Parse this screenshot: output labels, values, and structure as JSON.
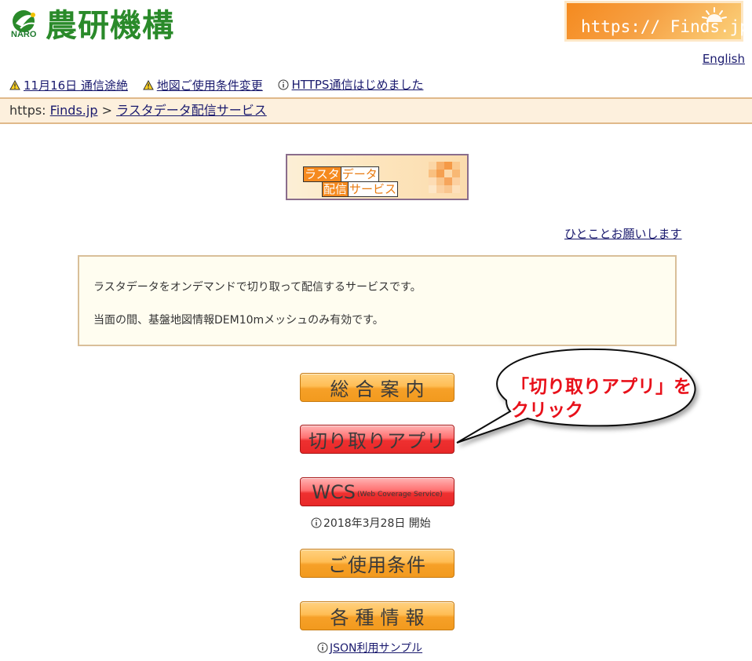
{
  "header": {
    "org_name": "農研機構",
    "org_sub": "NARO",
    "finds_banner": "https:// Finds.jp",
    "english_link": "English"
  },
  "notices": [
    {
      "icon": "warning-icon",
      "label": "11月16日 通信途絶"
    },
    {
      "icon": "warning-icon",
      "label": "地図ご使用条件変更"
    },
    {
      "icon": "info-icon",
      "label": "HTTPS通信はじめました"
    }
  ],
  "breadcrumb": {
    "prefix": "https:",
    "home": "Finds.jp",
    "separator": ">",
    "current": "ラスタデータ配信サービス"
  },
  "service_logo": {
    "line1_orange": "ラスタ",
    "line1_white": "データ",
    "line2_orange": "配信",
    "line2_white": "サービス"
  },
  "hitokoto_link": "ひとことお願いします",
  "info_box": {
    "line1": "ラスタデータをオンデマンドで切り取って配信するサービスです。",
    "line2": "当面の間、基盤地図情報DEM10mメッシュのみ有効です。"
  },
  "buttons": {
    "general_guide": "総合案内",
    "cut_app": "切り取りアプリ",
    "wcs_main": "WCS",
    "wcs_sub": "(Web Coverage Service)",
    "terms": "ご使用条件",
    "various_info": "各種情報"
  },
  "notes": {
    "wcs_start": "2018年3月28日 開始",
    "json_sample": "JSON利用サンプル"
  },
  "callout": {
    "line1": "「切り取りアプリ」を",
    "line2": "クリック"
  },
  "colors": {
    "naro_green": "#2a8a2a",
    "finds_orange": "#f58a1f",
    "breadcrumb_bg": "#fdf0dd",
    "callout_red": "#e8101a"
  }
}
